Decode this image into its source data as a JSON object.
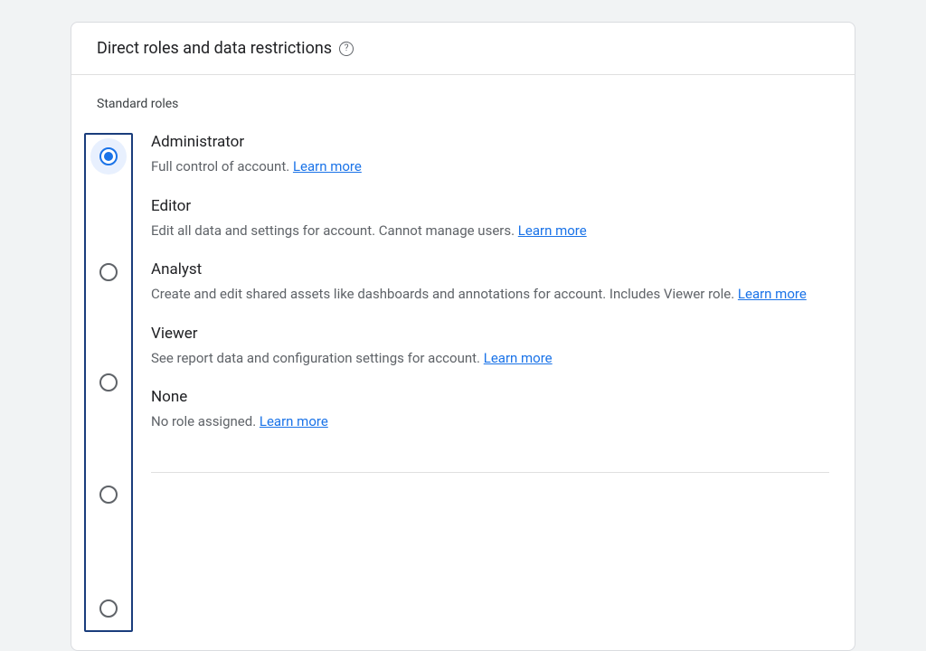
{
  "header": {
    "title": "Direct roles and data restrictions"
  },
  "section": {
    "label": "Standard roles"
  },
  "roles": [
    {
      "selected": true,
      "title": "Administrator",
      "desc": "Full control of account.",
      "link": "Learn more"
    },
    {
      "selected": false,
      "title": "Editor",
      "desc": "Edit all data and settings for account. Cannot manage users.",
      "link": "Learn more"
    },
    {
      "selected": false,
      "title": "Analyst",
      "desc": "Create and edit shared assets like dashboards and annotations for account. Includes Viewer role.",
      "link": "Learn more"
    },
    {
      "selected": false,
      "title": "Viewer",
      "desc": "See report data and configuration settings for account.",
      "link": "Learn more"
    },
    {
      "selected": false,
      "title": "None",
      "desc": "No role assigned.",
      "link": "Learn more"
    }
  ]
}
